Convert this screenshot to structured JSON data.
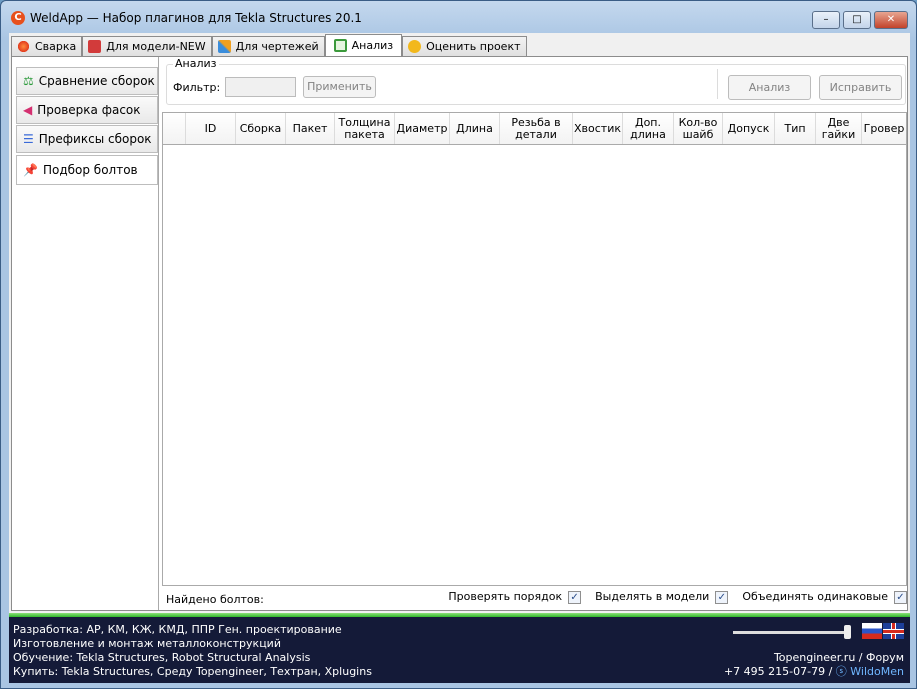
{
  "window": {
    "title": "WeldApp — Набор плагинов для Tekla Structures 20.1",
    "minimize": "–",
    "maximize": "□",
    "close": "✕"
  },
  "tabs": [
    {
      "label": "Сварка"
    },
    {
      "label": "Для модели-NEW"
    },
    {
      "label": "Для чертежей"
    },
    {
      "label": "Анализ"
    },
    {
      "label": "Оценить проект"
    }
  ],
  "sidebar": {
    "items": [
      {
        "label": "Сравнение сборок"
      },
      {
        "label": "Проверка фасок"
      },
      {
        "label": "Префиксы сборок"
      },
      {
        "label": "Подбор болтов"
      }
    ]
  },
  "analysis": {
    "group_label": "Анализ",
    "filter_label": "Фильтр:",
    "filter_value": "",
    "apply": "Применить",
    "analyze": "Анализ",
    "fix": "Исправить"
  },
  "grid": {
    "columns": [
      "ID",
      "Сборка",
      "Пакет",
      "Толщина пакета",
      "Диаметр",
      "Длина",
      "Резьба в детали",
      "Хвостик",
      "Доп. длина",
      "Кол-во шайб",
      "Допуск",
      "Тип",
      "Две гайки",
      "Гровер"
    ]
  },
  "status": {
    "found": "Найдено болтов:",
    "check_order": "Проверять порядок",
    "select_in_model": "Выделять в модели",
    "merge_same": "Объединять одинаковые",
    "check_mark": "✓"
  },
  "footer": {
    "lines": [
      "Разработка: АР, КМ, КЖ, КМД, ППР Ген. проектирование",
      "Изготовление и монтаж металлоконструкций",
      "Обучение: Tekla Structures, Robot Structural Analysis",
      "Купить: Tekla Structures, Среду Topengineer, Техтран, Xplugins"
    ],
    "site": "Topengineer.ru / Форум",
    "phone": "+7 495 215-07-79 / ",
    "skype": "WildoMen",
    "opacity_slider": 0.9
  }
}
